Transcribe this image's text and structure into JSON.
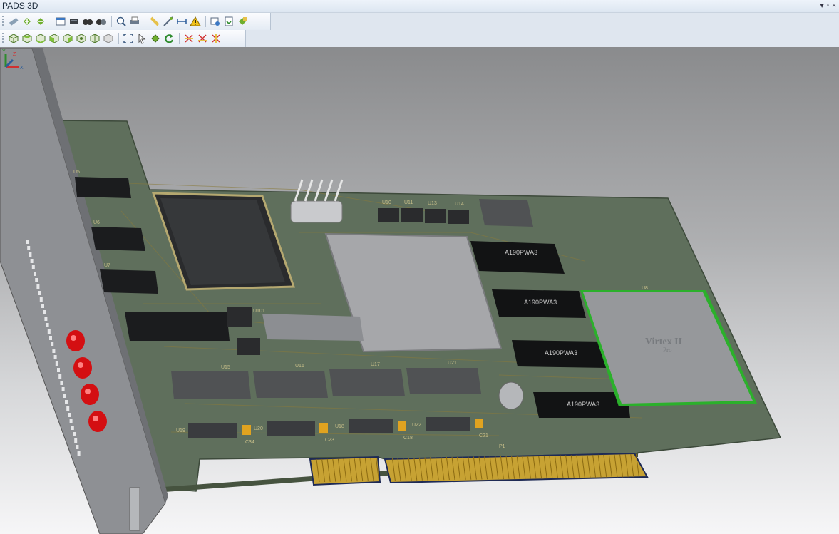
{
  "window": {
    "title": "PADS 3D",
    "controls": [
      "▾",
      "▫",
      "×"
    ]
  },
  "toolbar1": {
    "buttons": [
      "measure-icon",
      "add-icon",
      "remove-icon",
      "properties-icon",
      "layers-icon",
      "camera-icon",
      "capture-icon",
      "zoom-icon",
      "print-icon",
      "ruler-icon",
      "distance-icon",
      "fit-icon",
      "warning-icon",
      "report-icon",
      "export-icon",
      "settings-icon"
    ]
  },
  "toolbar2": {
    "buttons": [
      "view-iso-icon",
      "view-top-icon",
      "view-bottom-icon",
      "view-front-icon",
      "view-back-icon",
      "view-left-icon",
      "view-right-icon",
      "view-custom-icon",
      "zoom-extents-icon",
      "select-icon",
      "pan-icon",
      "rotate-icon",
      "clip-x-icon",
      "clip-y-icon",
      "clip-z-icon"
    ]
  },
  "board": {
    "ref_labels": [
      "U5",
      "U6",
      "U7",
      "U10",
      "U11",
      "U13",
      "U14",
      "U8",
      "U15",
      "U16",
      "U17",
      "U21",
      "U19",
      "U20",
      "U18",
      "U22",
      "C34",
      "C23",
      "C18",
      "C21",
      "P1",
      "U101"
    ],
    "chip_markings": [
      "A190PWA3",
      "A190PWA3",
      "A190PWA3",
      "A190PWA3"
    ],
    "fpga_text": "Virtex II",
    "fpga_subtext": "Pro",
    "led_color": "#d40f12",
    "pcb_color": "#5f6f5c",
    "gold_color": "#c7a233"
  },
  "axis": {
    "x": "X",
    "y": "Y",
    "z": "Z"
  }
}
